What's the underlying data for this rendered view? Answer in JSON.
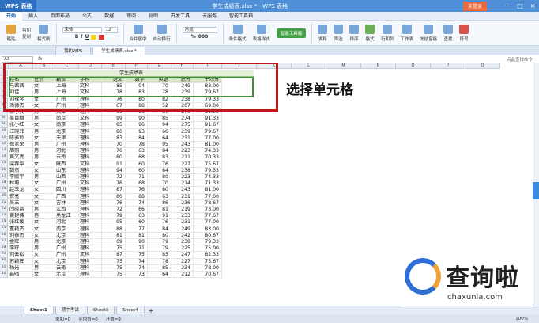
{
  "titlebar": {
    "app": "WPS 表格",
    "title": "学生成绩表.xlsx * - WPS 表格",
    "login": "未登录",
    "min": "−",
    "max": "□",
    "close": "×"
  },
  "menu": [
    "开始",
    "插入",
    "页面布局",
    "公式",
    "数据",
    "审阅",
    "视图",
    "开发工具",
    "云服务",
    "智能工具箱"
  ],
  "ribbon": {
    "paste": "粘贴",
    "cut": "剪切",
    "copy": "复制",
    "format_painter": "格式刷",
    "font": "宋体",
    "font_size": "12",
    "bold": "B",
    "italic": "I",
    "underline": "U",
    "merge": "合并居中",
    "wrap": "自动换行",
    "number_format": "常规",
    "cond_format": "条件格式",
    "table_style": "表格样式",
    "smart_toolbox": "智能工具箱",
    "sum": "求和",
    "filter": "筛选",
    "sort": "排序",
    "format": "格式",
    "row_col": "行和列",
    "worksheet": "工作表",
    "freeze": "冻结窗格",
    "find": "查找",
    "symbol": "符号"
  },
  "tabs": [
    "我的WPS",
    "学生成绩表.xlsx *"
  ],
  "formula": {
    "namebox": "A3",
    "fx": "fx",
    "search": "点此查找命令"
  },
  "grid": {
    "columns": [
      "A",
      "B",
      "C",
      "D",
      "E",
      "F",
      "G",
      "H",
      "I",
      "J",
      "K",
      "L",
      "M",
      "N",
      "O",
      "P",
      "Q"
    ],
    "sheet_title": "学生成绩表",
    "headers": [
      "姓名",
      "性别",
      "籍贯",
      "学科",
      "语文",
      "数学",
      "英语",
      "总分",
      "平均分"
    ],
    "rows": [
      [
        "马茜茜",
        "女",
        "上海",
        "文科",
        "85",
        "94",
        "70",
        "249",
        "83.00"
      ],
      [
        "刘佳",
        "男",
        "上海",
        "文科",
        "78",
        "83",
        "78",
        "239",
        "79.67"
      ],
      [
        "刘禄琴",
        "女",
        "广州",
        "理科",
        "76",
        "80",
        "82",
        "238",
        "79.33"
      ],
      [
        "汤德杰",
        "女",
        "广州",
        "理科",
        "67",
        "88",
        "52",
        "207",
        "69.00"
      ],
      [
        "余小灵",
        "男",
        "天津",
        "理科",
        "93",
        "90",
        "87",
        "270",
        "90.00"
      ],
      [
        "吴目醋",
        "男",
        "南京",
        "文科",
        "99",
        "90",
        "85",
        "274",
        "91.33"
      ],
      [
        "张小红",
        "女",
        "南京",
        "理科",
        "85",
        "96",
        "94",
        "275",
        "91.67"
      ],
      [
        "汪晓菲",
        "男",
        "北京",
        "理科",
        "80",
        "93",
        "66",
        "239",
        "79.67"
      ],
      [
        "陈雅玲",
        "女",
        "天津",
        "理科",
        "83",
        "84",
        "64",
        "231",
        "77.00"
      ],
      [
        "徐蓝荣",
        "男",
        "广州",
        "理科",
        "70",
        "78",
        "95",
        "243",
        "81.00"
      ],
      [
        "周照",
        "男",
        "河北",
        "理科",
        "76",
        "63",
        "84",
        "223",
        "74.33"
      ],
      [
        "黄文亮",
        "男",
        "云南",
        "理科",
        "60",
        "68",
        "83",
        "211",
        "70.33"
      ],
      [
        "梁荐华",
        "女",
        "陕西",
        "文科",
        "91",
        "60",
        "76",
        "227",
        "75.67"
      ],
      [
        "魏然",
        "女",
        "山东",
        "理科",
        "94",
        "60",
        "84",
        "238",
        "79.33"
      ],
      [
        "李鹏宇",
        "男",
        "山西",
        "理科",
        "72",
        "71",
        "80",
        "223",
        "74.33"
      ],
      [
        "林莉",
        "女",
        "广州",
        "文科",
        "76",
        "68",
        "70",
        "214",
        "71.33"
      ],
      [
        "赵玉龙",
        "女",
        "四川",
        "理科",
        "87",
        "76",
        "80",
        "243",
        "81.00"
      ],
      [
        "贺亮",
        "女",
        "广西",
        "理科",
        "80",
        "88",
        "63",
        "231",
        "77.00"
      ],
      [
        "吴王",
        "女",
        "吉林",
        "理科",
        "76",
        "74",
        "86",
        "236",
        "78.67"
      ],
      [
        "闫晓晶",
        "男",
        "江西",
        "理科",
        "72",
        "66",
        "81",
        "219",
        "73.00"
      ],
      [
        "黄建伟",
        "男",
        "黑龙江",
        "理科",
        "79",
        "63",
        "91",
        "233",
        "77.67"
      ],
      [
        "张红媛",
        "女",
        "河北",
        "理科",
        "95",
        "60",
        "76",
        "231",
        "77.00"
      ],
      [
        "董艳杰",
        "女",
        "南京",
        "理科",
        "88",
        "77",
        "84",
        "249",
        "83.00"
      ],
      [
        "刘泰杰",
        "女",
        "北京",
        "理科",
        "81",
        "81",
        "80",
        "242",
        "80.67"
      ],
      [
        "金辉",
        "男",
        "北京",
        "理科",
        "69",
        "90",
        "79",
        "238",
        "79.33"
      ],
      [
        "李辉",
        "男",
        "广州",
        "理科",
        "75",
        "71",
        "79",
        "225",
        "75.00"
      ],
      [
        "刘云松",
        "女",
        "广州",
        "文科",
        "87",
        "75",
        "85",
        "247",
        "82.33"
      ],
      [
        "苏颖辉",
        "女",
        "北京",
        "理科",
        "75",
        "74",
        "78",
        "227",
        "75.67"
      ],
      [
        "杨光",
        "男",
        "云南",
        "理科",
        "75",
        "74",
        "85",
        "234",
        "78.00"
      ],
      [
        "聂晴",
        "女",
        "北京",
        "理科",
        "75",
        "73",
        "64",
        "212",
        "70.67"
      ]
    ]
  },
  "annotation": "选择单元格",
  "sheets": [
    "Sheet1",
    "期中考试",
    "Sheet3",
    "Sheet4"
  ],
  "status": {
    "sum": "求和=0",
    "avg": "平均值=0",
    "count": "计数=9",
    "zoom": "100%"
  },
  "watermark": {
    "brand": "查询啦",
    "url": "chaxunla.com"
  }
}
